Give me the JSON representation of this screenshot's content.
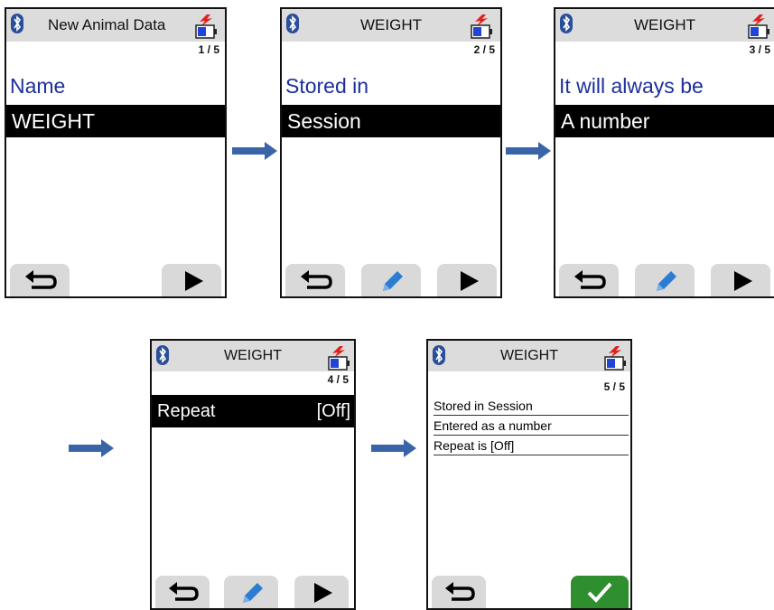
{
  "screens": [
    {
      "title": "New Animal Data",
      "page": "1 / 5",
      "label": "Name",
      "value": "WEIGHT",
      "buttons": [
        "back-icon",
        "play-icon"
      ]
    },
    {
      "title": "WEIGHT",
      "page": "2 / 5",
      "label": "Stored in",
      "value": "Session",
      "buttons": [
        "back-icon",
        "pencil-icon",
        "play-icon"
      ]
    },
    {
      "title": "WEIGHT",
      "page": "3 / 5",
      "label": "It will always be",
      "value": "A number",
      "buttons": [
        "back-icon",
        "pencil-icon",
        "play-icon"
      ]
    },
    {
      "title": "WEIGHT",
      "page": "4 / 5",
      "row_label": "Repeat",
      "row_value": "[Off]",
      "buttons": [
        "back-icon",
        "pencil-icon",
        "play-icon"
      ]
    },
    {
      "title": "WEIGHT",
      "page": "5 / 5",
      "summary": [
        "Stored in Session",
        "Entered as a number",
        "Repeat is [Off]"
      ],
      "buttons": [
        "back-icon",
        "checkmark-icon"
      ]
    }
  ],
  "colors": {
    "label_blue": "#1c2f9e",
    "pencil_blue": "#2b7cd3",
    "confirm_green": "#2f8f2f",
    "arrow_blue": "#3a64a8",
    "battery_red": "#e21e1e",
    "header_gray": "#dcdcdc"
  }
}
